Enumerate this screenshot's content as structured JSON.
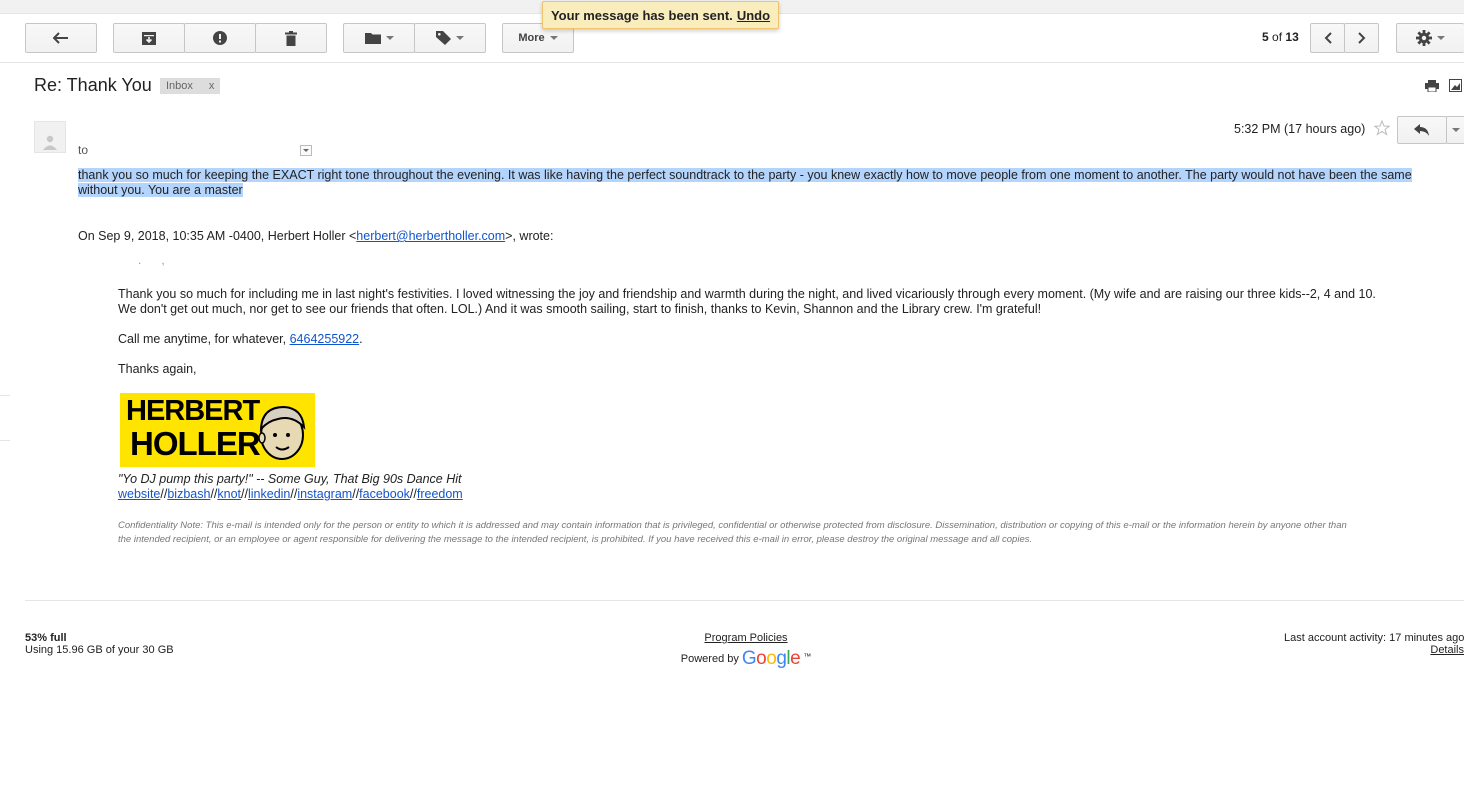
{
  "toast": {
    "message": "Your message has been sent.",
    "undo": "Undo"
  },
  "toolbar": {
    "more_label": "More",
    "pager_current": "5",
    "pager_of": "of",
    "pager_total": "13",
    "icons": [
      "back-arrow-icon",
      "archive-icon",
      "report-spam-icon",
      "trash-icon",
      "folder-icon",
      "tag-icon",
      "chevron-left-icon",
      "chevron-right-icon",
      "gear-icon"
    ]
  },
  "thread": {
    "subject": "Re: Thank You",
    "label": "Inbox",
    "label_remove": "x"
  },
  "message": {
    "to_label": "to",
    "timestamp": "5:32 PM (17 hours ago)",
    "body": "thank you so much for keeping the EXACT right tone throughout the evening. It was like having the perfect soundtrack to the party - you knew exactly how to move people from one moment to another. The party would not have been the same without you. You are a master",
    "quote_prefix": "On Sep 9, 2018, 10:35 AM -0400, Herbert Holler <",
    "quote_email": "herbert@herbertholler.com",
    "quote_suffix": ">, wrote:",
    "quoted_para1_line1": "Thank you so much for including me in last night's festivities. I loved witnessing the joy and friendship and warmth during the night, and lived vicariously through every moment. (My wife and are raising our three kids--2, 4 and 10.",
    "quoted_para1_line2": "We don't get out much, nor get to see our friends that often. LOL.) And it was smooth sailing, start to finish, thanks to Kevin, Shannon and the Library crew. I'm grateful!",
    "call_prefix": "Call me anytime, for whatever, ",
    "phone": "6464255922",
    "call_suffix": ".",
    "thanks": "Thanks again,",
    "logo_line1": "HERBERT",
    "logo_line2": "HOLLER",
    "tagline": "\"Yo DJ pump this party!\" -- Some Guy, That Big 90s Dance Hit",
    "links": [
      "website",
      "bizbash",
      "knot",
      "linkedin",
      "instagram",
      "facebook",
      "freedom"
    ],
    "link_sep": "//",
    "confidentiality_line1": "Confidentiality Note: This e-mail is intended only for the person or entity to which it is addressed and may contain information that is privileged, confidential or otherwise protected from disclosure. Dissemination, distribution or copying of this e-mail or the information herein by anyone other than",
    "confidentiality_line2": "the intended recipient, or an employee or agent responsible for delivering the message to the intended recipient, is prohibited. If you have received this e-mail in error, please destroy the original message and all copies."
  },
  "footer": {
    "usage_percent": "53% full",
    "usage_detail": "Using 15.96 GB of your 30 GB",
    "program_policies": "Program Policies",
    "powered_by": "Powered by",
    "google": "Google",
    "google_tm": "™",
    "last_activity": "Last account activity: 17 minutes ago",
    "details": "Details"
  },
  "colors": {
    "toast_bg": "#f9edbe",
    "link": "#1155cc",
    "selection": "#b3d4fc",
    "logo_yellow": "#ffe400"
  }
}
